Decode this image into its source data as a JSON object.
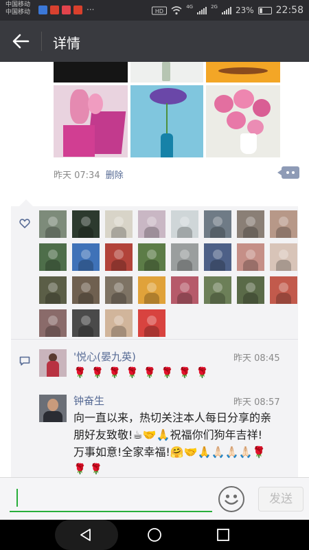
{
  "status_bar": {
    "carrier_1": "中国移动",
    "carrier_2": "中国移动",
    "network_1": "4G",
    "network_2": "2G",
    "battery": "23%",
    "time": "22:58",
    "app_colors": [
      "#3b78d8",
      "#d9412f",
      "#e2444c",
      "#d9402c"
    ],
    "more": "···"
  },
  "titlebar": {
    "back_icon": "back-arrow-icon",
    "title": "详情"
  },
  "post": {
    "photo_colors": {
      "dark": "#1a1a1a",
      "pink_flowers": "#c4327e",
      "blue_vase": "#7bbfd8",
      "pink_peony": "#e6e6e0",
      "gold_table": "#f0a22c"
    },
    "time": "昨天 07:34",
    "delete_label": "删除",
    "comment_button_icon": "comment-dots-icon"
  },
  "likes": {
    "icon": "heart-outline-icon",
    "count": 28,
    "avatar_colors": [
      "#7d8b7a",
      "#2c3a2e",
      "#d8d4c8",
      "#c9b7c4",
      "#cfd6d8",
      "#6f7b86",
      "#8a7f76",
      "#b79888",
      "#4e6e4a",
      "#3f72b8",
      "#b2433a",
      "#5c7c47",
      "#9a9e9e",
      "#4d6087",
      "#c58f87",
      "#d8c4b8",
      "#5b5e47",
      "#6f6050",
      "#7e7364",
      "#e0a23a",
      "#b65a6a",
      "#6c7f58",
      "#5a6a48",
      "#c25a4c",
      "#8a6b6a",
      "#4a4a4a",
      "#d1b59b",
      "#d8433f"
    ]
  },
  "comments_icon": "comment-bubble-icon",
  "comments": [
    {
      "name": "'悦心(晏九英)",
      "time": "昨天 08:45",
      "text": "🌹 🌹 🌹 🌹 🌹 🌹 🌹 🌹"
    },
    {
      "name": "钟奋生",
      "time": "昨天 08:57",
      "line1": "向一直以来，热切关注本人每日分享的亲",
      "line2": "朋好友致敬!☕🤝🙏祝福你们狗年吉祥!",
      "line3": "万事如意!全家幸福!🤗🤝🙏🙏🏻🙏🏻🙏🏻🌹",
      "line4": "🌹 🌹"
    }
  ],
  "input": {
    "emoji_icon": "emoji-smile-icon",
    "send_label": "发送"
  },
  "navbar": {
    "back": "nav-back-icon",
    "home": "nav-home-icon",
    "recent": "nav-recent-icon"
  }
}
